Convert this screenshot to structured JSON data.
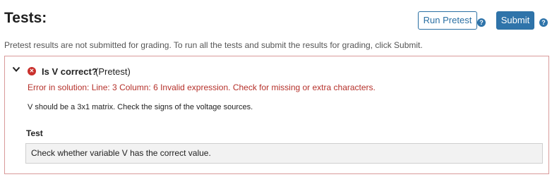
{
  "header": {
    "title": "Tests:",
    "run_pretest_label": "Run Pretest",
    "submit_label": "Submit",
    "help_glyph": "?"
  },
  "info_text": "Pretest results are not submitted for grading. To run all the tests and submit the results for grading, click Submit.",
  "result": {
    "name": "Is V correct?",
    "tag": "(Pretest)",
    "status_icon": "error-x-icon",
    "status_glyph": "✕",
    "error": "Error in solution: Line: 3 Column: 6 Invalid expression. Check for missing or extra characters.",
    "hint": "V should be a 3x1 matrix. Check the signs of the voltage sources.",
    "test_label": "Test",
    "test_description": "Check whether variable V has the correct value."
  },
  "colors": {
    "accent": "#2f74aa",
    "error": "#c9302c",
    "panel_border": "#d99a9a"
  }
}
